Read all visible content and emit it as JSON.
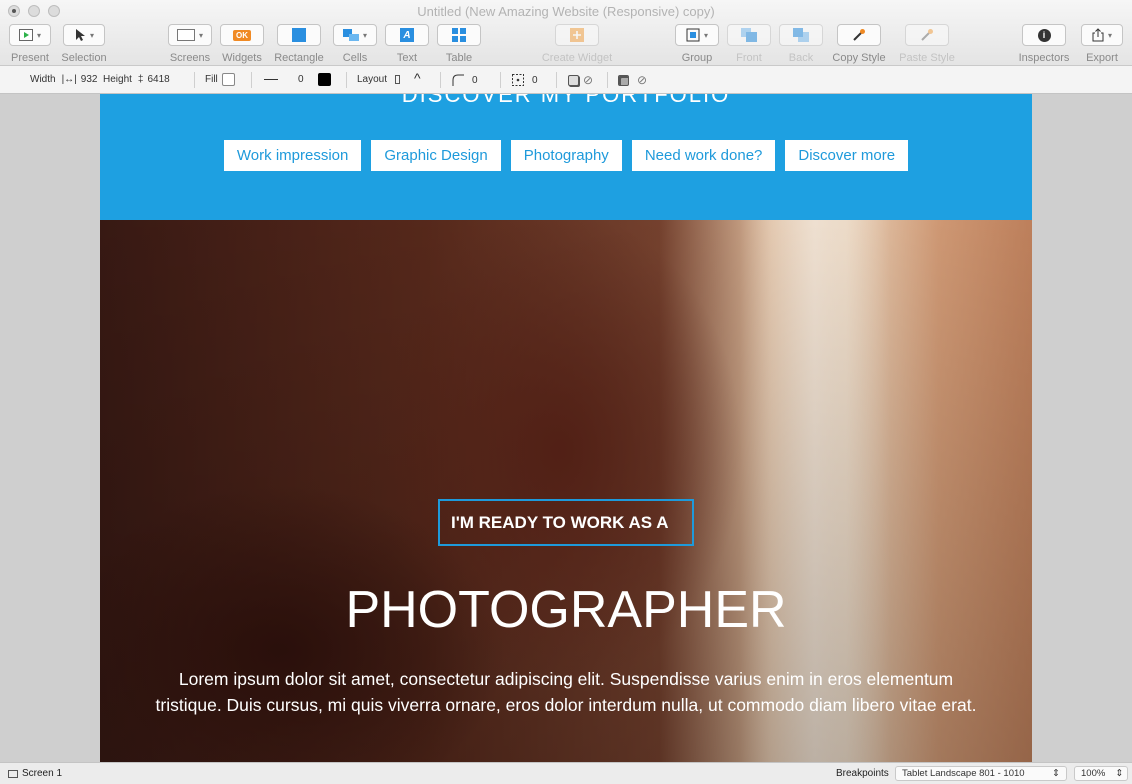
{
  "window": {
    "title": "Untitled (New Amazing Website (Responsive) copy)"
  },
  "toolbar": {
    "present": "Present",
    "selection": "Selection",
    "screens": "Screens",
    "widgets": "Widgets",
    "widgets_badge": "OK",
    "rectangle": "Rectangle",
    "cells": "Cells",
    "text": "Text",
    "text_icon": "A",
    "table": "Table",
    "create_widget": "Create Widget",
    "group": "Group",
    "front": "Front",
    "back": "Back",
    "copy_style": "Copy Style",
    "paste_style": "Paste Style",
    "inspectors": "Inspectors",
    "inspectors_icon": "i",
    "export": "Export"
  },
  "props": {
    "width_label": "Width",
    "width_value": "932",
    "height_label": "Height",
    "height_value": "6418",
    "fill_label": "Fill",
    "stroke_value": "0",
    "layout_label": "Layout",
    "radius_value": "0",
    "padding_value": "0"
  },
  "page": {
    "cut_heading": "DISCOVER MY PORTFOLIO",
    "nav": [
      "Work impression",
      "Graphic Design",
      "Photography",
      "Need work done?",
      "Discover more"
    ],
    "ready": "I'M READY TO WORK AS A",
    "title": "PHOTOGRAPHER",
    "body": "Lorem ipsum dolor sit amet, consectetur adipiscing elit. Suspendisse varius enim in eros elementum tristique. Duis cursus, mi quis viverra ornare, eros dolor interdum nulla, ut commodo diam libero vitae erat."
  },
  "status": {
    "screen": "Screen 1",
    "breakpoints_label": "Breakpoints",
    "breakpoint_value": "Tablet Landscape 801 - 1010",
    "zoom": "100%"
  },
  "colors": {
    "accent": "#1ea0e1"
  }
}
